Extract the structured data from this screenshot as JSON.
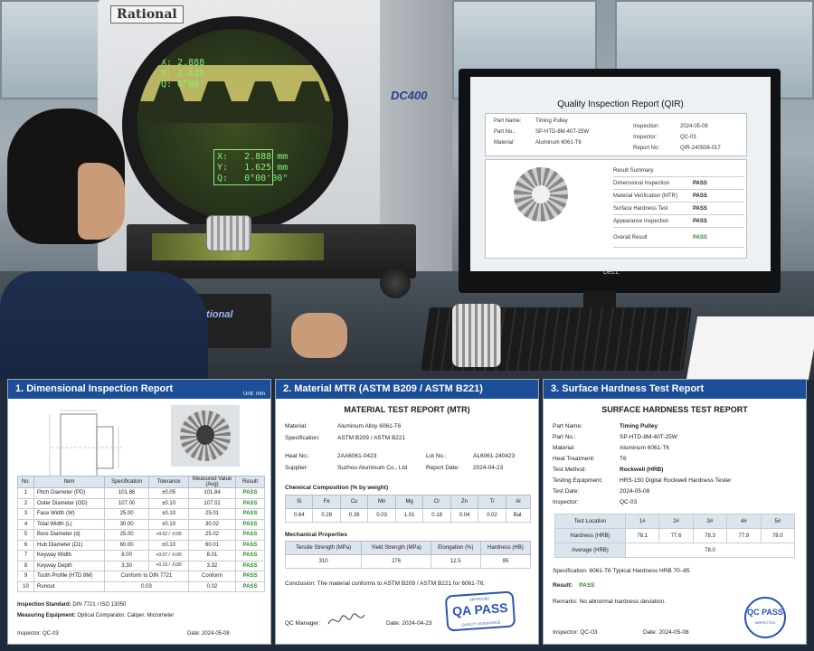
{
  "scene": {
    "machine_brand": "Rational",
    "machine_model": "DC400",
    "readout_top": "X: 2.888\nY: 1.625\nQ: 0°00'",
    "readout_box": "X:   2.888 mm\nY:   1.625 mm\nQ:   0°00'00\"",
    "base_brand": "Rational",
    "monitor_brand": "DELL",
    "qir": {
      "title": "Quality Inspection Report (QIR)",
      "left": [
        {
          "k": "Part Name:",
          "v": "Timing Pulley"
        },
        {
          "k": "Part No.:",
          "v": "SP-HTD-8M-40T-25W"
        },
        {
          "k": "Material:",
          "v": "Aluminum 6061-T6"
        }
      ],
      "right": [
        {
          "k": "Inspection:",
          "v": "2024-05-08"
        },
        {
          "k": "Inspector:",
          "v": "QC-03"
        },
        {
          "k": "Report No:",
          "v": "QIR-240508-017"
        }
      ],
      "summary_title": "Result Summary",
      "summary": [
        {
          "k": "Dimensional Inspection",
          "v": "PASS"
        },
        {
          "k": "Material Verification (MTR)",
          "v": "PASS"
        },
        {
          "k": "Surface Hardness Test",
          "v": "PASS"
        },
        {
          "k": "Appearance Inspection",
          "v": "PASS"
        }
      ],
      "overall_label": "Overall Result",
      "overall_value": "PASS"
    }
  },
  "panel1": {
    "title": "1. Dimensional Inspection Report",
    "unit": "Unit: mm",
    "headers": [
      "No.",
      "Item",
      "Specification",
      "Tolerance",
      "Measured Value (Avg)",
      "Result"
    ],
    "rows": [
      [
        "1",
        "Pitch Diameter (PD)",
        "101.86",
        "±0.05",
        "101.84",
        "PASS"
      ],
      [
        "2",
        "Outer Diameter (OD)",
        "107.00",
        "±0.10",
        "107.02",
        "PASS"
      ],
      [
        "3",
        "Face Width (W)",
        "25.00",
        "±0.10",
        "25.01",
        "PASS"
      ],
      [
        "4",
        "Total Width (L)",
        "30.00",
        "±0.10",
        "30.02",
        "PASS"
      ],
      [
        "5",
        "Bore Diameter (d)",
        "25.00",
        "+0.02 / -0.00",
        "25.02",
        "PASS"
      ],
      [
        "6",
        "Hub Diameter (D1)",
        "60.00",
        "±0.10",
        "60.01",
        "PASS"
      ],
      [
        "7",
        "Keyway Width",
        "8.00",
        "+0.07 / -0.00",
        "8.01",
        "PASS"
      ],
      [
        "8",
        "Keyway Depth",
        "3.30",
        "+0.10 / -0.00",
        "3.32",
        "PASS"
      ],
      [
        "9",
        "Tooth Profile (HTD 8M)",
        "Conform to DIN 7721",
        "",
        "Conform",
        "PASS"
      ],
      [
        "10",
        "Runout",
        "0.03",
        "",
        "0.02",
        "PASS"
      ]
    ],
    "standard_label": "Inspection Standard:",
    "standard_value": "DIN 7721 / ISO 13050",
    "equipment_label": "Measuring Equipment:",
    "equipment_value": "Optical Comparator, Caliper, Micrometer",
    "inspector": "Inspector:  QC-03",
    "date": "Date:  2024-05-08"
  },
  "panel2": {
    "title": "2. Material MTR (ASTM B209 / ASTM B221)",
    "doc_title": "MATERIAL TEST REPORT (MTR)",
    "material_label": "Material:",
    "material_value": "Aluminum Alloy 6061-T6",
    "spec_label": "Specification:",
    "spec_value": "ASTM B209 / ASTM B221",
    "heat_label": "Heat No.:",
    "heat_value": "2AA6061-0423",
    "lot_label": "Lot No.:",
    "lot_value": "AL6061-240423",
    "supplier_label": "Supplier:",
    "supplier_value": "Suzhou Aluminum Co., Ltd",
    "report_date_label": "Report Date:",
    "report_date_value": "2024-04-23",
    "chem_title": "Chemical Composition (% by weight)",
    "chem_headers": [
      "Si",
      "Fe",
      "Cu",
      "Mn",
      "Mg",
      "Cr",
      "Zn",
      "Ti",
      "Al"
    ],
    "chem_values": [
      "0.64",
      "0.28",
      "0.26",
      "0.03",
      "1.01",
      "0.18",
      "0.04",
      "0.02",
      "Bal."
    ],
    "mech_title": "Mechanical Properties",
    "mech_headers": [
      "Tensile Strength (MPa)",
      "Yield Strength (MPa)",
      "Elongation (%)",
      "Hardness (HB)"
    ],
    "mech_values": [
      "310",
      "276",
      "12.5",
      "95"
    ],
    "conclusion": "Conclusion:  The material conforms to ASTM B209 / ASTM B221 for 6061-T6.",
    "qc_manager": "QC Manager:",
    "date": "Date:  2024-04-23",
    "stamp_top": "APPROVED",
    "stamp_main": "QA PASS",
    "stamp_bottom": "QUALITY ASSURANCE"
  },
  "panel3": {
    "title": "3. Surface Hardness Test Report",
    "doc_title": "SURFACE HARDNESS TEST REPORT",
    "fields": [
      {
        "k": "Part Name:",
        "v": "Timing Pulley",
        "bold": true
      },
      {
        "k": "Part No.:",
        "v": "SP-HTD-8M-40T-25W"
      },
      {
        "k": "Material:",
        "v": "Aluminum 6061-T6"
      },
      {
        "k": "Heat Treatment:",
        "v": "T6"
      },
      {
        "k": "Test Method:",
        "v": "Rockwell (HRB)",
        "bold": true
      },
      {
        "k": "Testing Equipment:",
        "v": "HRS-150 Digital Rockwell Hardness Tester"
      },
      {
        "k": "Test Date:",
        "v": "2024-05-08"
      },
      {
        "k": "Inspector:",
        "v": "QC-03"
      }
    ],
    "loc_label": "Test Location",
    "locations": [
      "1#",
      "2#",
      "3#",
      "4#",
      "5#"
    ],
    "hard_label": "Hardness (HRB)",
    "hardness": [
      "78.1",
      "77.6",
      "78.3",
      "77.9",
      "78.0"
    ],
    "avg_label": "Average (HRB)",
    "avg_value": "78.0",
    "spec": "Specification:  6061-T6 Typical Hardness HRB 70–85",
    "result_label": "Result:",
    "result_value": "PASS",
    "remarks": "Remarks:  No abnormal hardness deviation.",
    "inspector": "Inspector:  QC-03",
    "date": "Date:  2024-05-08",
    "stamp_main": "QC PASS",
    "stamp_ring": "INSPECTED"
  }
}
